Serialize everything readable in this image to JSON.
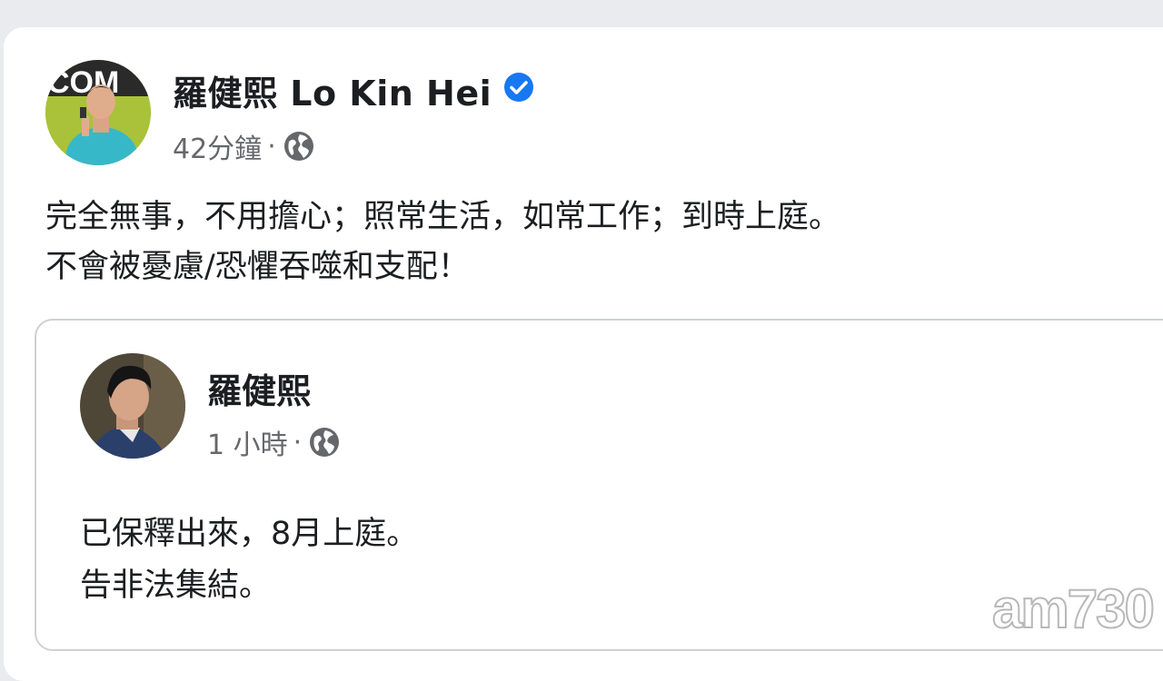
{
  "post": {
    "author": "羅健熙 Lo Kin Hei",
    "time": "42分鐘",
    "dot": "·",
    "text_line1": "完全無事，不用擔心；照常生活，如常工作；到時上庭。",
    "text_line2": "不會被憂慮/恐懼吞噬和支配！"
  },
  "shared_post": {
    "author": "羅健熙",
    "time": "1 小時",
    "dot": "·",
    "text_line1": "已保釋出來，8月上庭。",
    "text_line2": "告非法集結。"
  },
  "watermark": "am730",
  "icons": {
    "verified": "verified-badge-icon",
    "privacy": "globe-icon"
  },
  "colors": {
    "background": "#e9ebee",
    "verified_blue": "#1877f2",
    "meta_gray": "#65676b"
  }
}
